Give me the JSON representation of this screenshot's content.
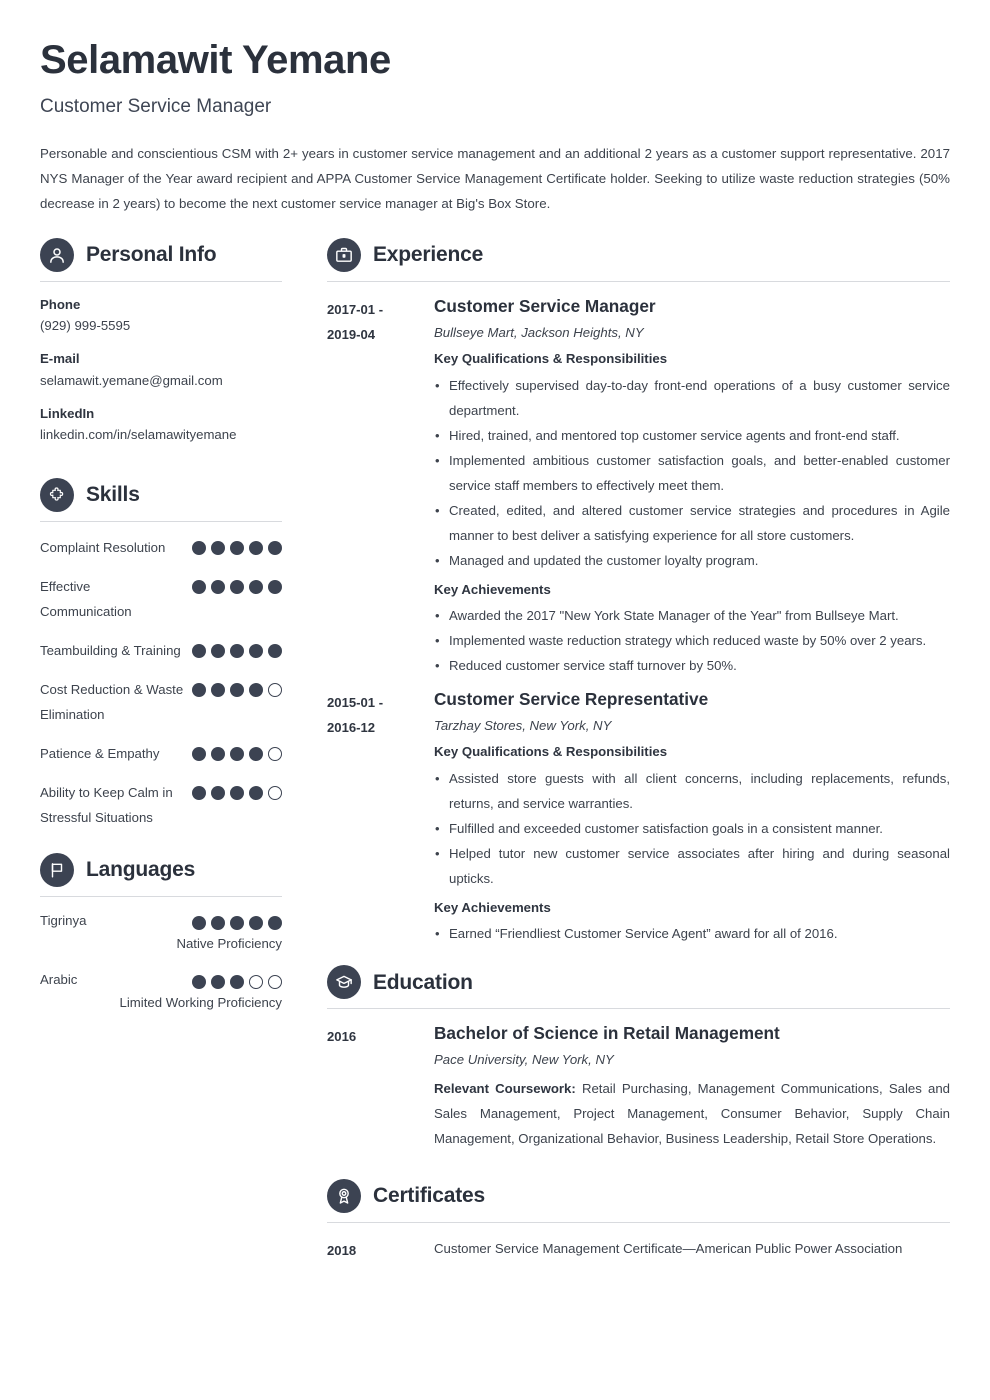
{
  "header": {
    "name": "Selamawit Yemane",
    "job_title": "Customer Service Manager",
    "summary": "Personable and conscientious CSM with 2+ years in customer service management and an additional 2 years as a customer support representative. 2017 NYS Manager of the Year award recipient and APPA Customer Service Management Certificate holder. Seeking to utilize waste reduction strategies (50% decrease in 2 years) to become the next customer service manager at Big's Box Store."
  },
  "colors": {
    "accent_dark": "#3c4352",
    "heading": "#2b313c",
    "body_text": "#3d434d",
    "rule": "#d8dade"
  },
  "personal_info": {
    "section_title": "Personal Info",
    "icon": "person-icon",
    "items": [
      {
        "label": "Phone",
        "value": "(929) 999-5595"
      },
      {
        "label": "E-mail",
        "value": "selamawit.yemane@gmail.com"
      },
      {
        "label": "LinkedIn",
        "value": "linkedin.com/in/selamawityemane"
      }
    ]
  },
  "skills": {
    "section_title": "Skills",
    "icon": "puzzle-piece-icon",
    "max_rating": 5,
    "items": [
      {
        "name": "Complaint Resolution",
        "rating": 5
      },
      {
        "name": "Effective Communication",
        "rating": 5
      },
      {
        "name": "Teambuilding & Training",
        "rating": 5
      },
      {
        "name": "Cost Reduction & Waste Elimination",
        "rating": 4
      },
      {
        "name": "Patience & Empathy",
        "rating": 4
      },
      {
        "name": "Ability to Keep Calm in Stressful Situations",
        "rating": 4
      }
    ]
  },
  "languages": {
    "section_title": "Languages",
    "icon": "flag-icon",
    "max_rating": 5,
    "items": [
      {
        "name": "Tigrinya",
        "rating": 5,
        "proficiency": "Native Proficiency"
      },
      {
        "name": "Arabic",
        "rating": 3,
        "proficiency": "Limited Working Proficiency"
      }
    ]
  },
  "experience": {
    "section_title": "Experience",
    "icon": "briefcase-icon",
    "entries": [
      {
        "date": "2017-01 - 2019-04",
        "date_line1": "2017-01 -",
        "date_line2": "2019-04",
        "title": "Customer Service Manager",
        "subtitle": "Bullseye Mart, Jackson Heights, NY",
        "qualifications_heading": "Key Qualifications & Responsibilities",
        "qualifications": [
          "Effectively supervised day-to-day front-end operations of a busy customer service department.",
          "Hired, trained, and mentored top customer service agents and front-end staff.",
          "Implemented ambitious customer satisfaction goals, and better-enabled customer service staff members to effectively meet them.",
          "Created, edited, and altered customer service strategies and procedures in Agile manner to best deliver a satisfying experience for all store customers.",
          "Managed and updated the customer loyalty program."
        ],
        "achievements_heading": "Key Achievements",
        "achievements": [
          "Awarded the 2017 \"New York State Manager of the Year\" from Bullseye Mart.",
          "Implemented waste reduction strategy which reduced waste by 50% over 2 years.",
          "Reduced customer service staff turnover by 50%."
        ]
      },
      {
        "date": "2015-01 - 2016-12",
        "date_line1": "2015-01 -",
        "date_line2": "2016-12",
        "title": "Customer Service Representative",
        "subtitle": "Tarzhay Stores, New York, NY",
        "qualifications_heading": "Key Qualifications & Responsibilities",
        "qualifications": [
          "Assisted store guests with all client concerns, including replacements, refunds, returns, and service warranties.",
          "Fulfilled and exceeded customer satisfaction goals in a consistent manner.",
          "Helped tutor new customer service associates after hiring and during seasonal upticks."
        ],
        "achievements_heading": "Key Achievements",
        "achievements": [
          "Earned “Friendliest Customer Service Agent” award for all of 2016."
        ]
      }
    ]
  },
  "education": {
    "section_title": "Education",
    "icon": "graduation-cap-icon",
    "entries": [
      {
        "date": "2016",
        "title": "Bachelor of Science in Retail Management",
        "subtitle": "Pace University, New York, NY",
        "coursework_label": "Relevant Coursework:",
        "coursework": "Retail Purchasing, Management Communications, Sales and Sales Management, Project Management, Consumer Behavior, Supply Chain Management, Organizational Behavior, Business Leadership, Retail Store Operations."
      }
    ]
  },
  "certificates": {
    "section_title": "Certificates",
    "icon": "award-ribbon-icon",
    "entries": [
      {
        "date": "2018",
        "text": "Customer Service Management Certificate—American Public Power Association"
      }
    ]
  }
}
